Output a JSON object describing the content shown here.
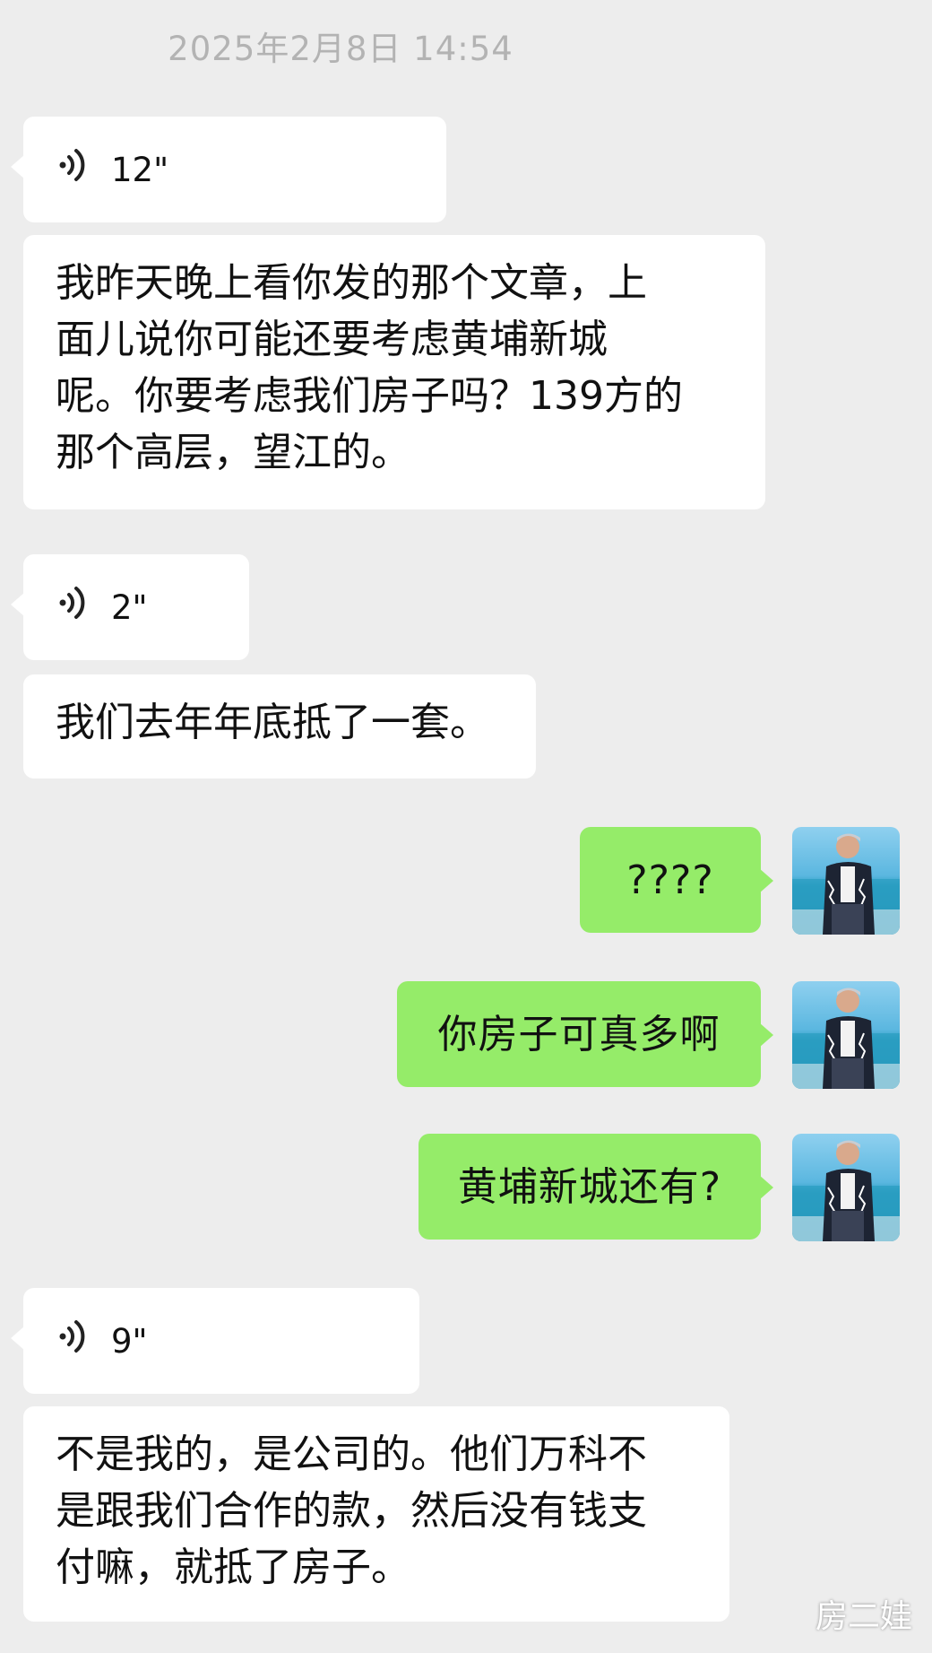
{
  "timestamp": "2025年2月8日 14:54",
  "messages": {
    "voice1": {
      "duration": "12\""
    },
    "text1": {
      "lines": [
        "我昨天晚上看你发的那个文章，上",
        "面儿说你可能还要考虑黄埔新城",
        "呢。你要考虑我们房子吗？139方的",
        "那个高层，望江的。"
      ]
    },
    "voice2": {
      "duration": "2\""
    },
    "text2": {
      "text": "我们去年年底抵了一套。"
    },
    "out1": {
      "text": "????"
    },
    "out2": {
      "text": "你房子可真多啊"
    },
    "out3": {
      "text": "黄埔新城还有?"
    },
    "voice3": {
      "duration": "9\""
    },
    "text3": {
      "lines": [
        "不是我的，是公司的。他们万科不",
        "是跟我们合作的款，然后没有钱支",
        "付嘛，就抵了房子。"
      ]
    }
  },
  "watermark": "房二娃",
  "colors": {
    "background": "#ededed",
    "incoming": "#ffffff",
    "outgoing": "#95ec69",
    "timestamp": "#b3b3b3"
  },
  "icons": {
    "voice": "voice-wave-icon",
    "avatar": "avatar-photo"
  }
}
